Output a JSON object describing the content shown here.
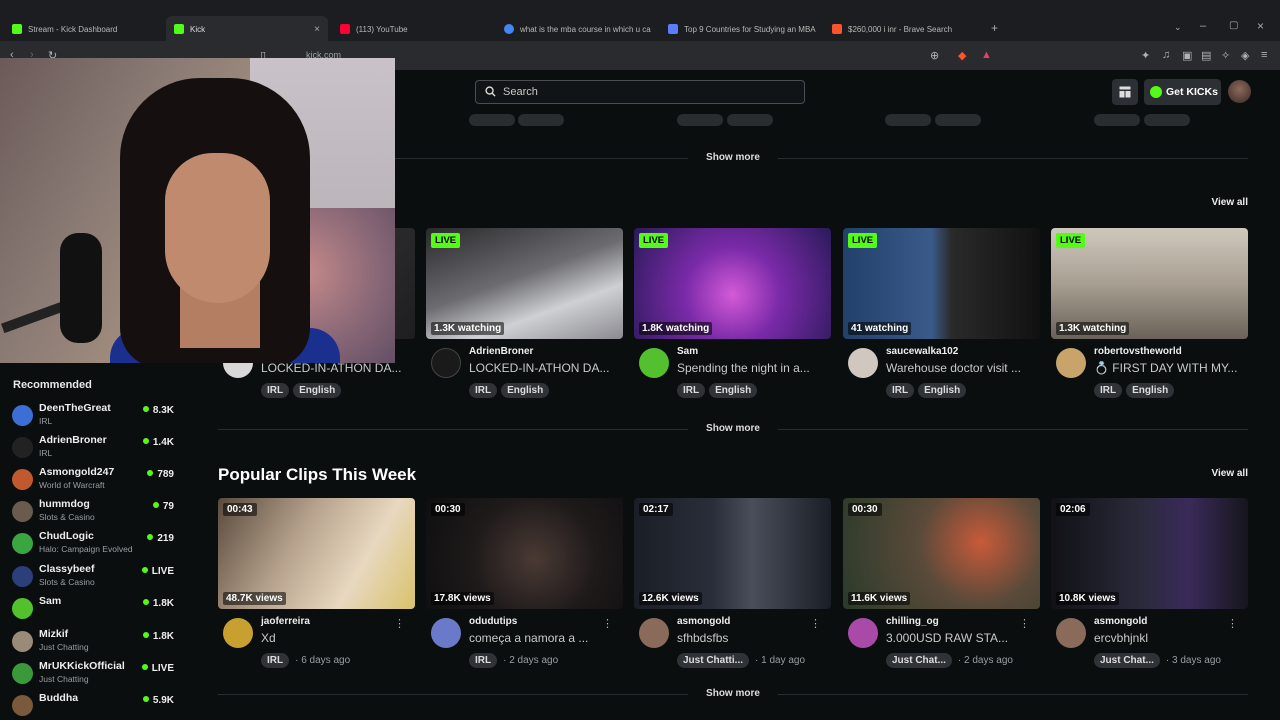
{
  "browser": {
    "tabs": [
      {
        "label": "Stream - Kick Dashboard",
        "fav_color": "#53fc18",
        "fav_icon": "kick-icon",
        "active": false
      },
      {
        "label": "Kick",
        "fav_color": "#53fc18",
        "fav_icon": "kick-icon",
        "active": true
      },
      {
        "label": "(113) YouTube",
        "fav_color": "#ff0033",
        "fav_icon": "youtube-icon",
        "active": false
      },
      {
        "label": "what is the mba course in which u ca",
        "fav_color": "#4285f4",
        "fav_icon": "google-icon",
        "active": false
      },
      {
        "label": "Top 9 Countries for Studying an MBA",
        "fav_color": "#5c7cfa",
        "fav_icon": "page-icon",
        "active": false
      },
      {
        "label": "$260,000 i inr - Brave Search",
        "fav_color": "#fb542b",
        "fav_icon": "brave-icon",
        "active": false
      }
    ],
    "url": "kick.com",
    "tab_close": "×",
    "new_tab": "+"
  },
  "header": {
    "search_placeholder": "Search",
    "get_kicks_label": "Get KICKs"
  },
  "sidebar": {
    "title": "Recommended",
    "items": [
      {
        "name": "DeenTheGreat",
        "category": "IRL",
        "count": "8.3K",
        "live_dot": true,
        "avatar_color": "#3b6fd6"
      },
      {
        "name": "AdrienBroner",
        "category": "IRL",
        "count": "1.4K",
        "live_dot": true,
        "avatar_color": "#222222"
      },
      {
        "name": "Asmongold247",
        "category": "World of Warcraft",
        "count": "789",
        "live_dot": true,
        "avatar_color": "#c05a2e"
      },
      {
        "name": "hummdog",
        "category": "Slots & Casino",
        "count": "79",
        "live_dot": true,
        "avatar_color": "#6b5a4e"
      },
      {
        "name": "ChudLogic",
        "category": "Halo: Campaign Evolved",
        "count": "219",
        "live_dot": true,
        "avatar_color": "#3aa640"
      },
      {
        "name": "Classybeef",
        "category": "Slots & Casino",
        "count": "LIVE",
        "live_dot": true,
        "avatar_color": "#2d3f7a"
      },
      {
        "name": "Sam",
        "category": "",
        "count": "1.8K",
        "live_dot": true,
        "avatar_color": "#53c02e"
      },
      {
        "name": "Mizkif",
        "category": "Just Chatting",
        "count": "1.8K",
        "live_dot": true,
        "avatar_color": "#9a8a7a"
      },
      {
        "name": "MrUKKickOfficial",
        "category": "Just Chatting",
        "count": "LIVE",
        "live_dot": true,
        "avatar_color": "#3a9a3a"
      },
      {
        "name": "Buddha",
        "category": "",
        "count": "5.9K",
        "live_dot": true,
        "avatar_color": "#7a5a3a"
      }
    ]
  },
  "sections": {
    "show_more": "Show more",
    "view_all": "View all",
    "clips_title": "Popular Clips This Week"
  },
  "live_cards": [
    {
      "badge": "LIVE",
      "viewers": "",
      "name": "",
      "title": "LOCKED-IN-ATHON DA...",
      "tags": [
        "IRL",
        "English"
      ],
      "thumb": "#3a3a3d"
    },
    {
      "badge": "LIVE",
      "viewers": "1.3K watching",
      "name": "AdrienBroner",
      "title": "LOCKED-IN-ATHON DA...",
      "tags": [
        "IRL",
        "English"
      ],
      "thumb": "#6b6b70"
    },
    {
      "badge": "LIVE",
      "viewers": "1.8K watching",
      "name": "Sam",
      "title": "Spending the night in a...",
      "tags": [
        "IRL",
        "English"
      ],
      "thumb": "#5b2a8a"
    },
    {
      "badge": "LIVE",
      "viewers": "41 watching",
      "name": "saucewalka102",
      "title": "Warehouse doctor visit ...",
      "tags": [
        "IRL",
        "English"
      ],
      "thumb": "#2c3e5a"
    },
    {
      "badge": "LIVE",
      "viewers": "1.3K watching",
      "name": "robertovstheworld",
      "title": "💍 FIRST DAY WITH MY...",
      "tags": [
        "IRL",
        "English"
      ],
      "thumb": "#8a7f72"
    }
  ],
  "clip_cards": [
    {
      "duration": "00:43",
      "views": "48.7K views",
      "name": "jaoferreira",
      "title": "Xd",
      "tag": "IRL",
      "ago": "· 6 days ago",
      "thumb": "#9a8a78"
    },
    {
      "duration": "00:30",
      "views": "17.8K views",
      "name": "odudutips",
      "title": "começa a namora a ...",
      "tag": "IRL",
      "ago": "· 2 days ago",
      "thumb": "#1a1a1c"
    },
    {
      "duration": "02:17",
      "views": "12.6K views",
      "name": "asmongold",
      "title": "sfhbdsfbs",
      "tag": "Just Chatti...",
      "ago": "· 1 day ago",
      "thumb": "#2a2e3a"
    },
    {
      "duration": "00:30",
      "views": "11.6K views",
      "name": "chilling_og",
      "title": "3.000USD RAW STA...",
      "tag": "Just Chat...",
      "ago": "· 2 days ago",
      "thumb": "#3a4a3a"
    },
    {
      "duration": "02:06",
      "views": "10.8K views",
      "name": "asmongold",
      "title": "ercvbhjnkl",
      "tag": "Just Chat...",
      "ago": "· 3 days ago",
      "thumb": "#1e1e28"
    }
  ]
}
